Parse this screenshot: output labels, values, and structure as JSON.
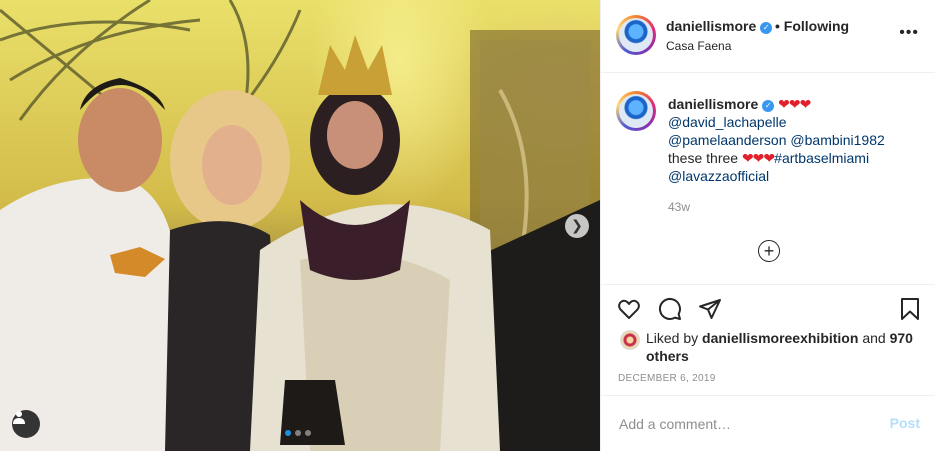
{
  "post": {
    "username": "daniellismore",
    "following_label": "• Following",
    "location": "Casa Faena",
    "more_label": "•••"
  },
  "caption": {
    "username": "daniellismore",
    "hearts_1": "❤❤❤",
    "mention_1": "@david_lachapelle",
    "mention_2": "@pamelaanderson",
    "mention_3": "@bambini1982",
    "text": "these three",
    "hearts_2": "❤❤❤",
    "hashtag": "#artbaselmiami",
    "mention_4": "@lavazzaofficial",
    "time_ago": "43w"
  },
  "likes": {
    "prefix": "Liked by",
    "liker": "daniellismoreexhibition",
    "and": "and",
    "others": "970 others"
  },
  "date": "DECEMBER 6, 2019",
  "comment_box": {
    "placeholder": "Add a comment…",
    "post_label": "Post"
  },
  "carousel": {
    "next_glyph": "❯",
    "current": 1,
    "total": 3
  },
  "icons": {
    "like": "heart-icon",
    "comment": "comment-icon",
    "share": "paper-plane-icon",
    "save": "bookmark-icon",
    "load_more": "plus-circle-icon",
    "tagged_users": "user-icon"
  },
  "colors": {
    "link": "#00376b",
    "verified": "#3897f0",
    "post_disabled": "#b2dffc",
    "muted": "#8e8e8e"
  }
}
